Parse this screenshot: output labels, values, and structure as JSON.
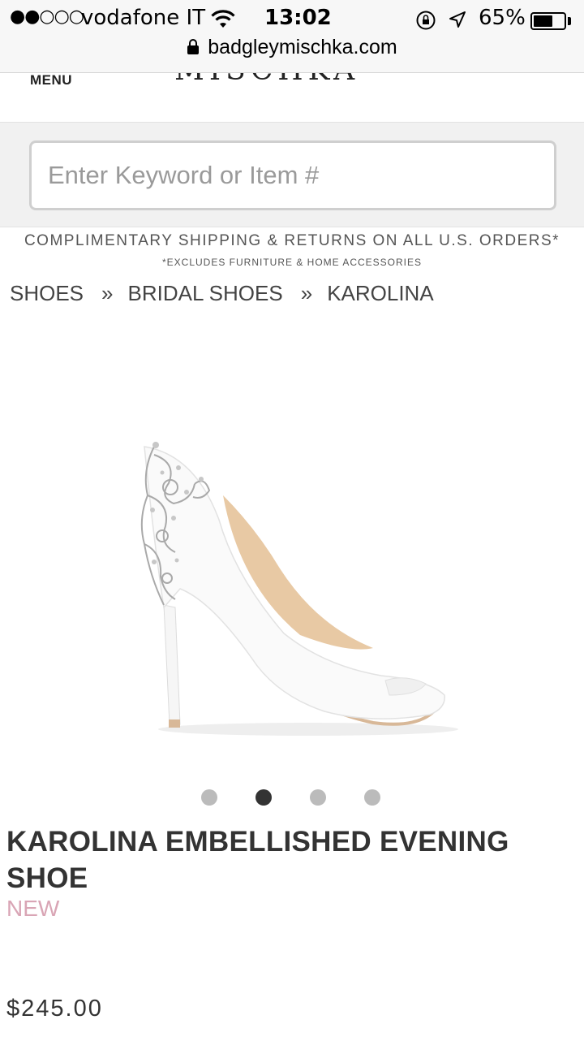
{
  "status_bar": {
    "signal": "●●○○○",
    "carrier": "vodafone IT",
    "time": "13:02",
    "battery": "65%",
    "battery_level": 0.65
  },
  "browser": {
    "url": "badgleymischka.com"
  },
  "header": {
    "menu_label": "MENU",
    "logo_text": "MISCHKA"
  },
  "search": {
    "placeholder": "Enter Keyword or Item #",
    "value": ""
  },
  "promo": {
    "main": "COMPLIMENTARY SHIPPING & RETURNS ON ALL U.S. ORDERS*",
    "sub": "*EXCLUDES FURNITURE & HOME ACCESSORIES"
  },
  "breadcrumb": {
    "items": [
      "SHOES",
      "BRIDAL SHOES",
      "KAROLINA"
    ],
    "separator": "»"
  },
  "carousel": {
    "count": 4,
    "active_index": 1
  },
  "product": {
    "title": "KAROLINA EMBELLISHED EVENING SHOE",
    "badge": "NEW",
    "price": "$245.00"
  },
  "colors": {
    "badge": "#d9a5b5",
    "dot_active": "#333333",
    "dot_inactive": "#bbbbbb"
  }
}
